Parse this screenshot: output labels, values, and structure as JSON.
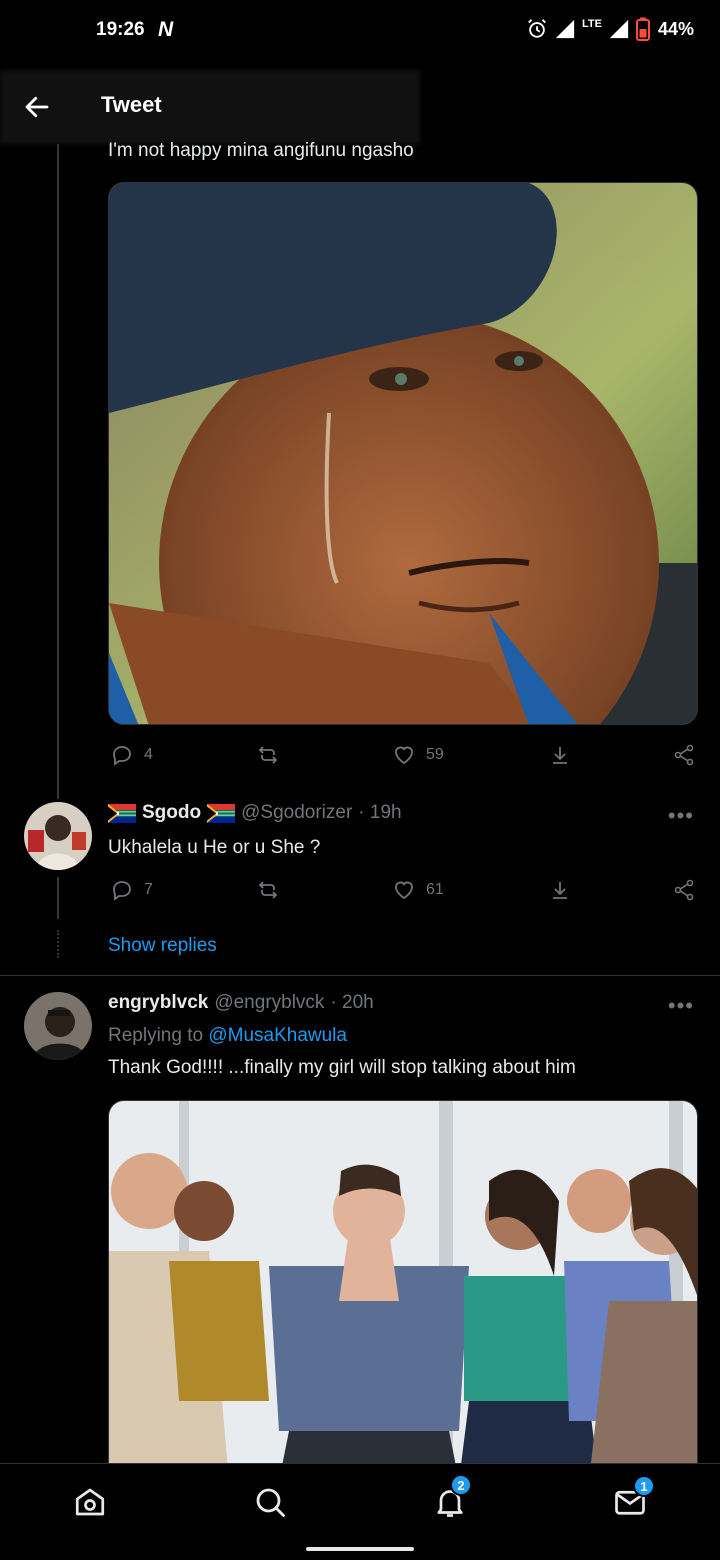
{
  "status_bar": {
    "time": "19:26",
    "carrier_glyph": "N",
    "network": "LTE",
    "battery": "44%"
  },
  "header": {
    "title": "Tweet"
  },
  "tweets": [
    {
      "text": "I'm not happy mina angifunu ngasho",
      "media": "photo",
      "replies": "4",
      "retweets": "",
      "likes": "59"
    },
    {
      "display_name": "Sgodo",
      "handle": "@Sgodorizer",
      "time": "· 19h",
      "text": "Ukhalela u He or u She ?",
      "replies": "7",
      "retweets": "",
      "likes": "61",
      "show_replies": "Show replies"
    },
    {
      "display_name": "engryblvck",
      "handle": "@engryblvck",
      "time": "· 20h",
      "replying_prefix": "Replying to ",
      "replying_to": "@MusaKhawula",
      "text": "Thank God!!!! ...finally my girl will stop talking about him",
      "media": "photo"
    }
  ],
  "bottom_nav": {
    "notifications_badge": "2",
    "messages_badge": "1"
  },
  "colors": {
    "background": "#000000",
    "accent": "#1d9bf0",
    "muted": "#71767b",
    "text": "#e7e9ea"
  }
}
